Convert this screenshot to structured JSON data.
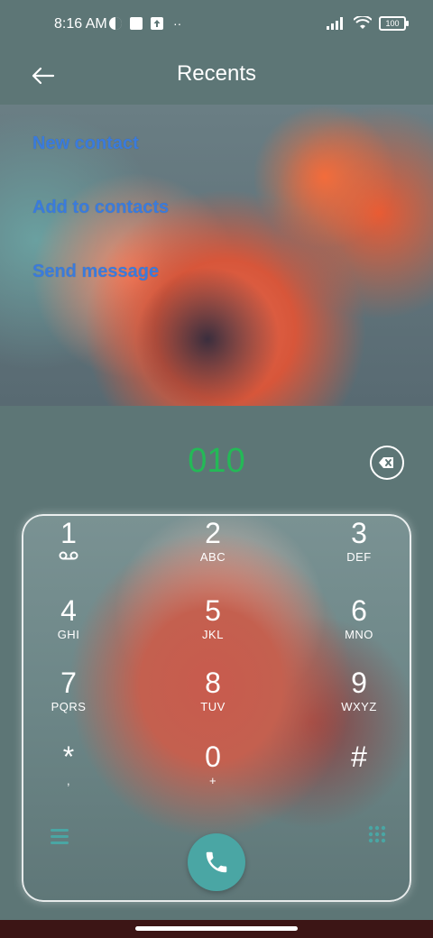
{
  "status_bar": {
    "time": "8:16 AM",
    "battery": "100"
  },
  "header": {
    "title": "Recents"
  },
  "actions": [
    {
      "label": "New contact"
    },
    {
      "label": "Add to contacts"
    },
    {
      "label": "Send message"
    }
  ],
  "dial": {
    "number": "010"
  },
  "keys": [
    {
      "digit": "1",
      "letters": ""
    },
    {
      "digit": "2",
      "letters": "ABC"
    },
    {
      "digit": "3",
      "letters": "DEF"
    },
    {
      "digit": "4",
      "letters": "GHI"
    },
    {
      "digit": "5",
      "letters": "JKL"
    },
    {
      "digit": "6",
      "letters": "MNO"
    },
    {
      "digit": "7",
      "letters": "PQRS"
    },
    {
      "digit": "8",
      "letters": "TUV"
    },
    {
      "digit": "9",
      "letters": "WXYZ"
    },
    {
      "digit": "*",
      "letters": ","
    },
    {
      "digit": "0",
      "letters": "+"
    },
    {
      "digit": "#",
      "letters": ""
    }
  ],
  "colors": {
    "number": "#24b957",
    "action_link": "#3a7bdc",
    "call_button": "#4aa6a4",
    "background": "#5d7676"
  },
  "icons": {
    "back": "arrow-left-icon",
    "backspace": "backspace-icon",
    "voicemail": "voicemail-icon",
    "menu": "menu-icon",
    "dialpad": "dialpad-icon",
    "call": "phone-icon"
  }
}
